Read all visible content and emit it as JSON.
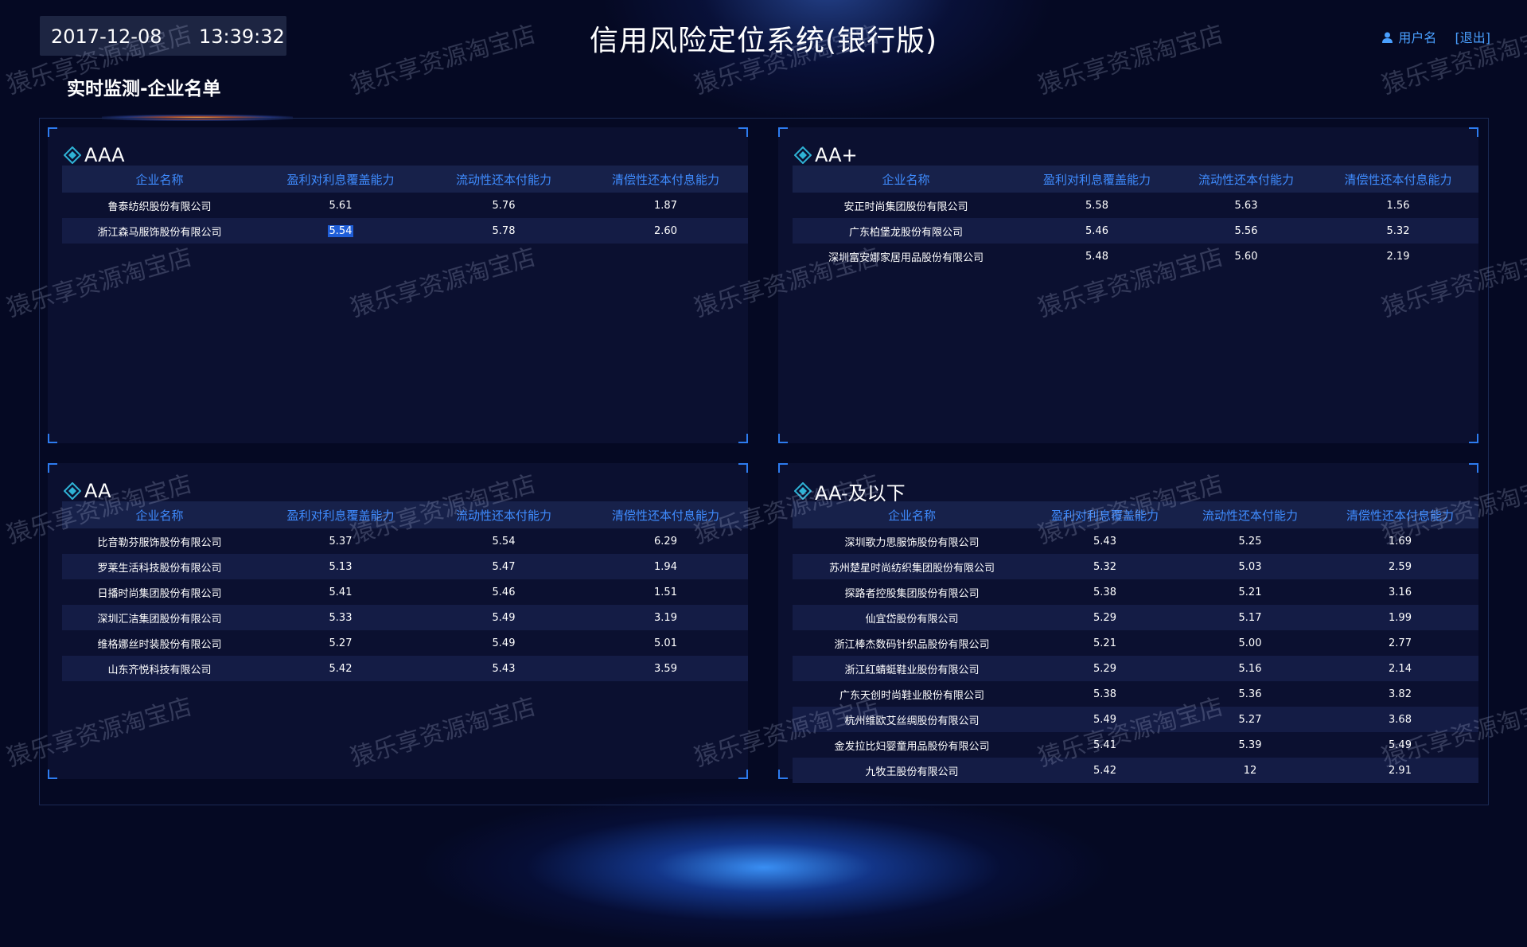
{
  "header": {
    "date": "2017-12-08",
    "time": "13:39:32",
    "title": "信用风险定位系统(银行版)",
    "user_label": "用户名",
    "logout_label": "[退出]",
    "subtitle": "实时监测-企业名单"
  },
  "columns": [
    "企业名称",
    "盈利对利息覆盖能力",
    "流动性还本付能力",
    "清偿性还本付息能力"
  ],
  "panels": {
    "aaa": {
      "title": "AAA",
      "rows": [
        [
          "鲁泰纺织股份有限公司",
          "5.61",
          "5.76",
          "1.87"
        ],
        [
          "浙江森马服饰股份有限公司",
          "5.54",
          "5.78",
          "2.60"
        ]
      ]
    },
    "aa_plus": {
      "title": "AA+",
      "rows": [
        [
          "安正时尚集团股份有限公司",
          "5.58",
          "5.63",
          "1.56"
        ],
        [
          "广东柏堡龙股份有限公司",
          "5.46",
          "5.56",
          "5.32"
        ],
        [
          "深圳富安娜家居用品股份有限公司",
          "5.48",
          "5.60",
          "2.19"
        ]
      ]
    },
    "aa": {
      "title": "AA",
      "rows": [
        [
          "比音勒芬服饰股份有限公司",
          "5.37",
          "5.54",
          "6.29"
        ],
        [
          "罗莱生活科技股份有限公司",
          "5.13",
          "5.47",
          "1.94"
        ],
        [
          "日播时尚集团股份有限公司",
          "5.41",
          "5.46",
          "1.51"
        ],
        [
          "深圳汇洁集团股份有限公司",
          "5.33",
          "5.49",
          "3.19"
        ],
        [
          "维格娜丝时装股份有限公司",
          "5.27",
          "5.49",
          "5.01"
        ],
        [
          "山东齐悦科技有限公司",
          "5.42",
          "5.43",
          "3.59"
        ]
      ]
    },
    "aa_minus": {
      "title": "AA-及以下",
      "rows": [
        [
          "深圳歌力思服饰股份有限公司",
          "5.43",
          "5.25",
          "1.69"
        ],
        [
          "苏州楚星时尚纺织集团股份有限公司",
          "5.32",
          "5.03",
          "2.59"
        ],
        [
          "探路者控股集团股份有限公司",
          "5.38",
          "5.21",
          "3.16"
        ],
        [
          "仙宜岱股份有限公司",
          "5.29",
          "5.17",
          "1.99"
        ],
        [
          "浙江棒杰数码针织品股份有限公司",
          "5.21",
          "5.00",
          "2.77"
        ],
        [
          "浙江红蜻蜓鞋业股份有限公司",
          "5.29",
          "5.16",
          "2.14"
        ],
        [
          "广东天创时尚鞋业股份有限公司",
          "5.38",
          "5.36",
          "3.82"
        ],
        [
          "杭州维欧艾丝绸股份有限公司",
          "5.49",
          "5.27",
          "3.68"
        ],
        [
          "金发拉比妇婴童用品股份有限公司",
          "5.41",
          "5.39",
          "5.49"
        ],
        [
          "九牧王股份有限公司",
          "5.42",
          "12",
          "2.91"
        ]
      ]
    }
  },
  "watermark": "猿乐享资源淘宝店",
  "colors": {
    "background": "#050923",
    "panel": "#0b1030",
    "header_row": "#17214a",
    "accent_blue": "#3f8cff",
    "corner": "#2d7cf0",
    "diamond": "#2fb3d6"
  }
}
